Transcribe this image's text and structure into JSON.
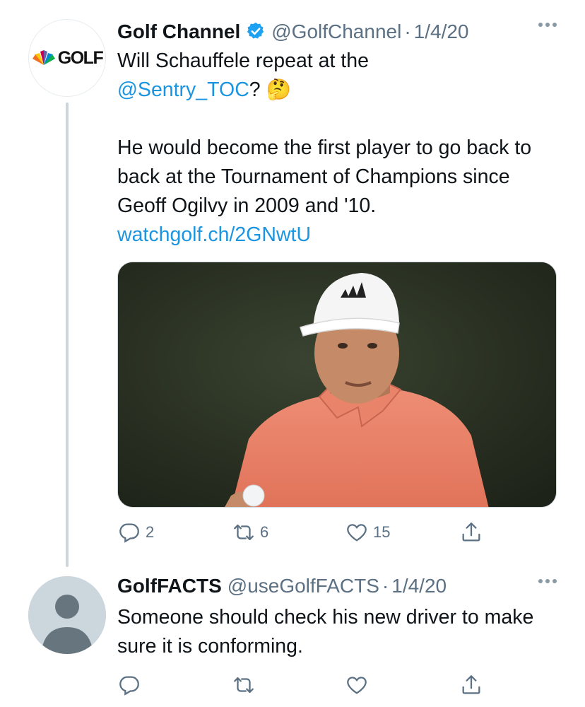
{
  "tweets": [
    {
      "author_name": "Golf Channel",
      "handle": "@GolfChannel",
      "separator": "·",
      "date": "1/4/20",
      "avatar_logo_text": "GOLF",
      "text_line1": "Will Schauffele repeat at the",
      "mention": "@Sentry_TOC",
      "mention_suffix": "?",
      "emoji": "🤔",
      "paragraph2": "He would become the first player to go back to back at the Tournament of Champions since Geoff Ogilvy in 2009 and '10.",
      "link_text": "watchgolf.ch/2GNwtU",
      "actions": {
        "replies": "2",
        "retweets": "6",
        "likes": "15"
      }
    },
    {
      "author_name": "GolfFACTS",
      "handle": "@useGolfFACTS",
      "separator": "·",
      "date": "1/4/20",
      "text": "Someone should check his new driver to make sure it is conforming."
    }
  ],
  "colors": {
    "link": "#1b95e0",
    "muted": "#5b7083",
    "verified": "#1da1f2",
    "thread_line": "#ccd6dd",
    "shirt": "#e9836a"
  },
  "icons": [
    "verified-badge-icon",
    "more-icon",
    "reply-icon",
    "retweet-icon",
    "like-icon",
    "share-icon",
    "peacock-icon",
    "default-avatar-icon"
  ]
}
